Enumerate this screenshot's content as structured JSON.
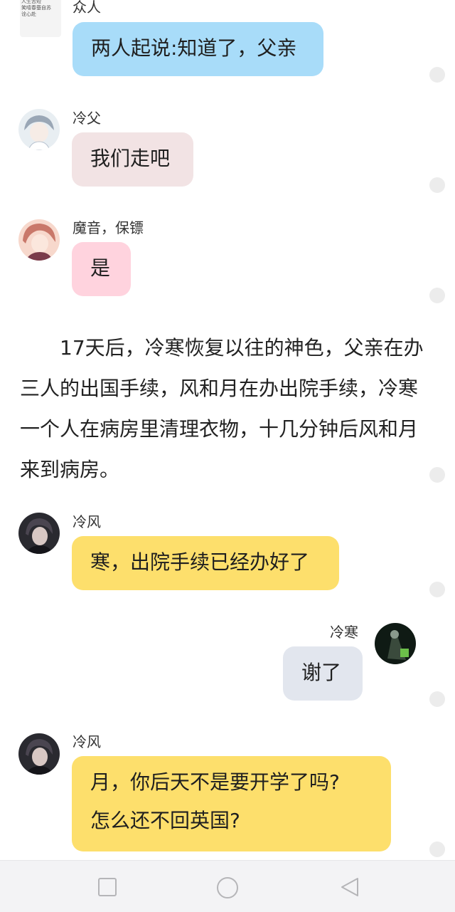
{
  "messages": [
    {
      "speaker": "众人",
      "text": "两人起说:知道了，父亲",
      "avatar_text": "人生苦短\n笑噎春蚕自苏\n诠心赴"
    },
    {
      "speaker": "冷父",
      "text": "我们走吧"
    },
    {
      "speaker": "魔音，保镖",
      "text": "是"
    },
    {
      "speaker": "冷风",
      "text": "寒，出院手续已经办好了"
    },
    {
      "speaker": "冷寒",
      "text": "谢了"
    },
    {
      "speaker": "冷风",
      "text_line1": "月，你后天不是要开学了吗?",
      "text_line2": "怎么还不回英国?"
    }
  ],
  "narration": "17天后，冷寒恢复以往的神色，父亲在办三人的出国手续，风和月在办出院手续，冷寒一个人在病房里清理衣物，十几分钟后风和月来到病房。",
  "colors": {
    "bubble_blue": "#a8dcf9",
    "bubble_gray_pink": "#f2e3e4",
    "bubble_pink": "#ffd3de",
    "bubble_yellow": "#fddf6c",
    "bubble_gray_blue": "#e2e6ee"
  },
  "navbar": {
    "icons": [
      "square-icon",
      "circle-icon",
      "triangle-back-icon"
    ]
  }
}
